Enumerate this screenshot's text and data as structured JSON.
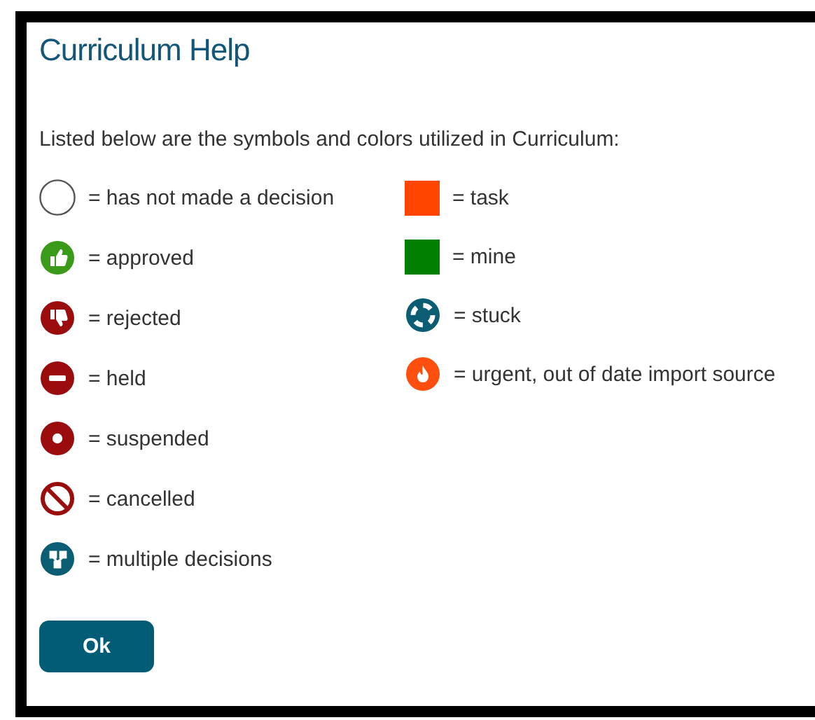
{
  "dialog": {
    "title": "Curriculum Help",
    "intro": "Listed below are the symbols and colors utilized in Curriculum:"
  },
  "columns": [
    [
      {
        "kind": "undecided",
        "label": "= has not made a decision"
      },
      {
        "kind": "approved",
        "label": "= approved"
      },
      {
        "kind": "rejected",
        "label": "= rejected"
      },
      {
        "kind": "held",
        "label": "= held"
      },
      {
        "kind": "suspended",
        "label": "= suspended"
      },
      {
        "kind": "cancelled",
        "label": "= cancelled"
      },
      {
        "kind": "multiple",
        "label": "= multiple decisions"
      }
    ],
    [
      {
        "kind": "swatch",
        "color": "#ff4500",
        "label": "= task"
      },
      {
        "kind": "swatch",
        "color": "#008000",
        "label": "= mine"
      },
      {
        "kind": "stuck",
        "label": "= stuck"
      },
      {
        "kind": "urgent",
        "label": "= urgent, out of date import source"
      }
    ]
  ],
  "buttons": [
    "Ok"
  ]
}
